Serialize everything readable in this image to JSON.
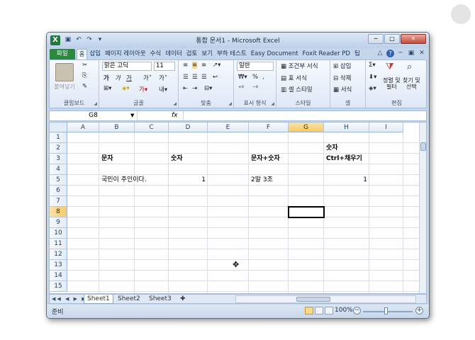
{
  "window": {
    "title": "통합 문서1 - Microsoft Excel"
  },
  "qat": {
    "icons": [
      "save-icon",
      "undo-icon",
      "redo-icon",
      "customize-icon"
    ]
  },
  "tabs": [
    "파일",
    "홈",
    "삽입",
    "페이지 레이아웃",
    "수식",
    "데이터",
    "검토",
    "보기",
    "부하 테스트",
    "Easy Document",
    "Foxit Reader PD",
    "팀"
  ],
  "ribbon": {
    "clipboard": {
      "paste": "붙여넣기",
      "label": "클립보드"
    },
    "font": {
      "name": "맑은 고딕",
      "size": "11",
      "bold": "가",
      "italic": "가",
      "underline": "가",
      "label": "글꼴"
    },
    "alignment": {
      "label": "맞춤"
    },
    "number": {
      "format": "일반",
      "percent": "%",
      "comma": ",",
      "label": "표시 형식"
    },
    "styles": {
      "conditional": "조건부 서식",
      "table": "표 서식",
      "cell": "셀 스타일",
      "label": "스타일"
    },
    "cells": {
      "insert": "삽입",
      "delete": "삭제",
      "format": "서식",
      "label": "셀"
    },
    "editing": {
      "sort": "정렬 및\n필터",
      "find": "찾기 및\n선택",
      "label": "편집"
    }
  },
  "formula": {
    "namebox": "G8",
    "fx": "fx",
    "value": ""
  },
  "columns": [
    "A",
    "B",
    "C",
    "D",
    "E",
    "F",
    "G",
    "H",
    "I"
  ],
  "rows": [
    "1",
    "2",
    "3",
    "4",
    "5",
    "6",
    "7",
    "8",
    "9",
    "10",
    "11",
    "12",
    "13",
    "14",
    "15"
  ],
  "selected": {
    "col": "G",
    "row": "8"
  },
  "cells": {
    "H2": "숫자",
    "B3": "문자",
    "D3": "숫자",
    "F3": "문자+숫자",
    "H3": "Ctrl+채우기",
    "B5": "국민이 주인이다.",
    "D5": "1",
    "F5": "2말 3조",
    "H5": "1"
  },
  "sheets": [
    "Sheet1",
    "Sheet2",
    "Sheet3"
  ],
  "status": {
    "ready": "준비",
    "zoom": "100%"
  }
}
